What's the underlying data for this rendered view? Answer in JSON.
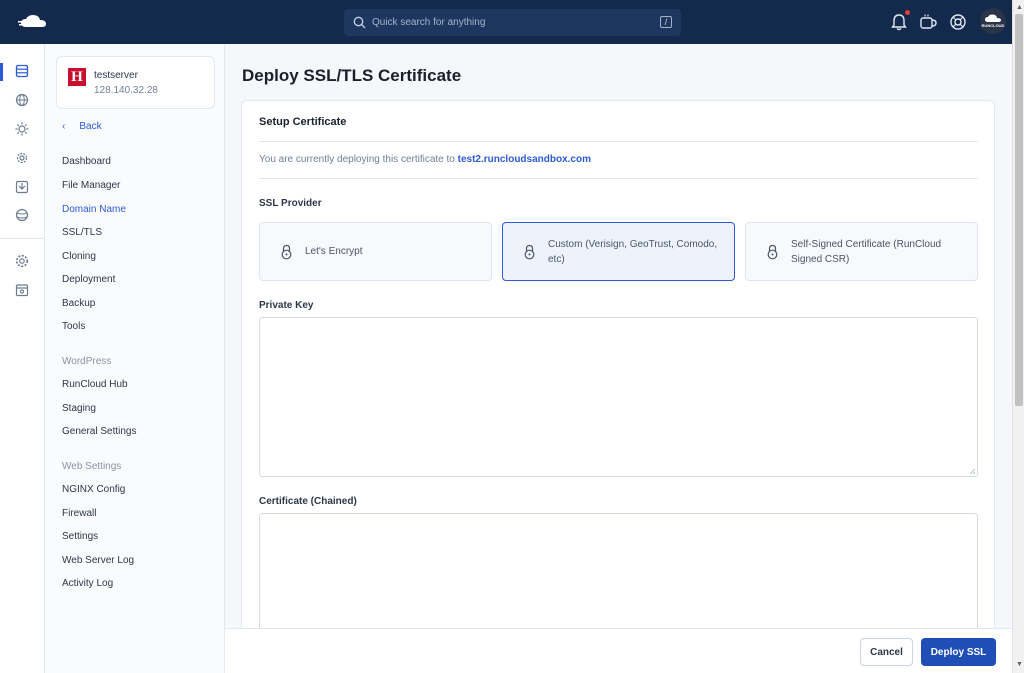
{
  "colors": {
    "topbar": "#132a4d",
    "accent": "#2c5bd6",
    "primary_button": "#1f4fb6",
    "notification_dot": "#e53e3e",
    "server_logo": "#c8102e"
  },
  "header": {
    "search_placeholder": "Quick search for anything",
    "search_shortcut": "/",
    "icons": [
      "bell-icon",
      "coffee-icon",
      "help-icon"
    ],
    "avatar_text": "RUNCLOUD"
  },
  "rail": {
    "icons": [
      "servers-icon",
      "globe-icon",
      "sun-icon",
      "cloud-gear-icon",
      "inbox-icon",
      "network-icon",
      "settings-icon",
      "archive-icon"
    ]
  },
  "sidebar": {
    "server": {
      "logo_letter": "H",
      "name": "testserver",
      "ip": "128.140.32.28"
    },
    "back_label": "Back",
    "items": [
      {
        "label": "Dashboard"
      },
      {
        "label": "File Manager"
      },
      {
        "label": "Domain Name"
      },
      {
        "label": "SSL/TLS"
      },
      {
        "label": "Cloning"
      },
      {
        "label": "Deployment"
      },
      {
        "label": "Backup"
      },
      {
        "label": "Tools"
      }
    ],
    "wordpress_group": "WordPress",
    "wordpress_items": [
      {
        "label": "RunCloud Hub"
      },
      {
        "label": "Staging"
      },
      {
        "label": "General Settings"
      }
    ],
    "web_group": "Web Settings",
    "web_items": [
      {
        "label": "NGINX Config"
      },
      {
        "label": "Firewall"
      },
      {
        "label": "Settings"
      },
      {
        "label": "Web Server Log"
      },
      {
        "label": "Activity Log"
      }
    ]
  },
  "main": {
    "title": "Deploy SSL/TLS Certificate",
    "panel_title": "Setup Certificate",
    "deploy_text": "You are currently deploying this certificate to",
    "deploy_domain": "test2.runcloudsandbox.com",
    "ssl_provider_label": "SSL Provider",
    "providers": [
      {
        "label": "Let's Encrypt",
        "selected": false
      },
      {
        "label": "Custom (Verisign, GeoTrust, Comodo, etc)",
        "selected": true
      },
      {
        "label": "Self-Signed Certificate (RunCloud Signed CSR)",
        "selected": false
      }
    ],
    "private_key_label": "Private Key",
    "private_key_value": "",
    "certificate_label": "Certificate (Chained)",
    "certificate_value": ""
  },
  "footer": {
    "cancel_label": "Cancel",
    "deploy_label": "Deploy SSL"
  }
}
